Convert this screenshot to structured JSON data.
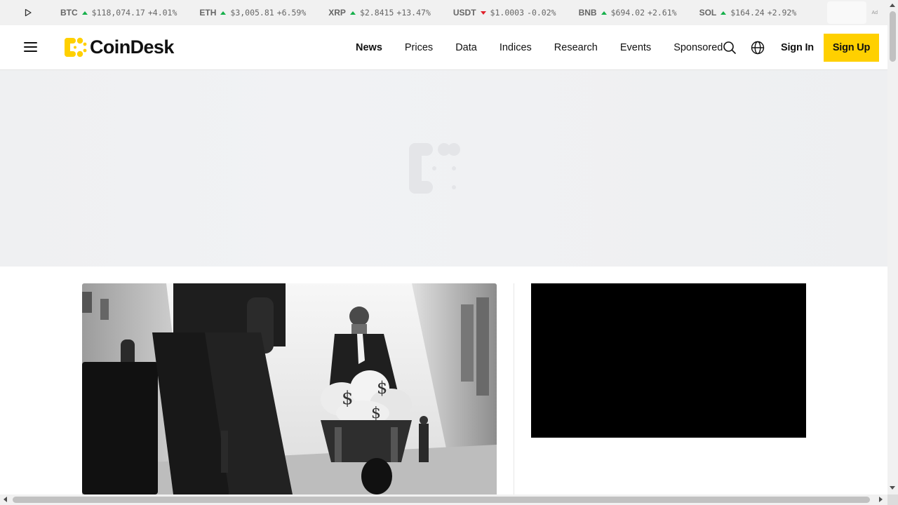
{
  "ticker": {
    "items": [
      {
        "symbol": "BTC",
        "price": "$118,074.17",
        "change": "+4.01%",
        "direction": "up"
      },
      {
        "symbol": "ETH",
        "price": "$3,005.81",
        "change": "+6.59%",
        "direction": "up"
      },
      {
        "symbol": "XRP",
        "price": "$2.8415",
        "change": "+13.47%",
        "direction": "up"
      },
      {
        "symbol": "USDT",
        "price": "$1.0003",
        "change": "-0.02%",
        "direction": "down"
      },
      {
        "symbol": "BNB",
        "price": "$694.02",
        "change": "+2.61%",
        "direction": "up"
      },
      {
        "symbol": "SOL",
        "price": "$164.24",
        "change": "+2.92%",
        "direction": "up"
      }
    ],
    "ad_label": "Ad",
    "colors": {
      "up": "#15b04a",
      "down": "#e0212b"
    }
  },
  "header": {
    "logo_text": "CoinDesk",
    "nav": [
      "News",
      "Prices",
      "Data",
      "Indices",
      "Research",
      "Events",
      "Sponsored"
    ],
    "active_nav": "News",
    "sign_in": "Sign In",
    "sign_up": "Sign Up",
    "icons": [
      "hamburger-menu-icon",
      "search-icon",
      "globe-icon"
    ],
    "colors": {
      "brand_yellow": "#ffd000"
    }
  }
}
